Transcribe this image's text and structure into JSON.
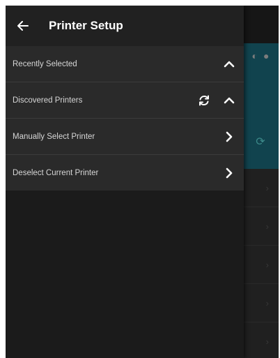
{
  "header": {
    "title": "Printer Setup",
    "back_icon": "back-arrow-icon"
  },
  "menu": {
    "items": [
      {
        "label": "Recently Selected",
        "icons": [
          "chevron-up-icon"
        ]
      },
      {
        "label": "Discovered Printers",
        "icons": [
          "refresh-icon",
          "chevron-up-icon"
        ]
      },
      {
        "label": "Manually Select Printer",
        "icons": [
          "chevron-right-icon"
        ]
      },
      {
        "label": "Deselect Current Printer",
        "icons": [
          "chevron-right-icon"
        ]
      }
    ]
  },
  "colors": {
    "drawer_bg": "#1b1b1b",
    "menu_bg": "#2a2a2a",
    "text": "#d6d6d6",
    "accent_teal": "#11434e"
  }
}
